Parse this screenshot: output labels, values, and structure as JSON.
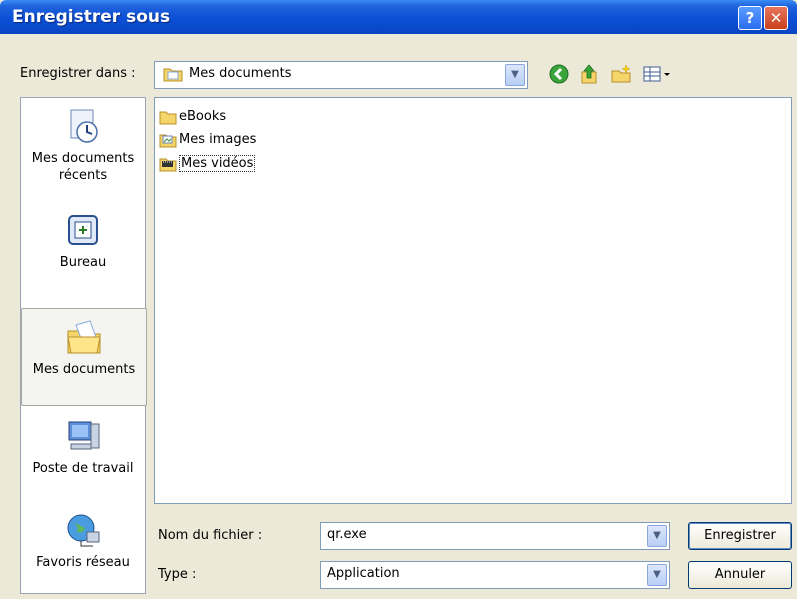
{
  "window": {
    "title": "Enregistrer sous",
    "help_label": "?",
    "close_label": "✕"
  },
  "toolbar": {
    "save_in_label": "Enregistrer dans :",
    "save_in_value": "Mes documents",
    "icons": [
      "back-icon",
      "up-folder-icon",
      "new-folder-icon",
      "view-menu-icon"
    ]
  },
  "places": [
    {
      "label_line1": "Mes documents",
      "label_line2": "récents",
      "icon": "recent-documents-icon",
      "selected": false
    },
    {
      "label_line1": "Bureau",
      "label_line2": "",
      "icon": "desktop-icon",
      "selected": false
    },
    {
      "label_line1": "Mes documents",
      "label_line2": "",
      "icon": "my-documents-icon",
      "selected": true
    },
    {
      "label_line1": "Poste de travail",
      "label_line2": "",
      "icon": "my-computer-icon",
      "selected": false
    },
    {
      "label_line1": "Favoris réseau",
      "label_line2": "",
      "icon": "network-places-icon",
      "selected": false
    }
  ],
  "files": [
    {
      "name": "eBooks",
      "icon": "folder-icon"
    },
    {
      "name": "Mes images",
      "icon": "pictures-folder-icon"
    },
    {
      "name": "Mes vidéos",
      "icon": "videos-folder-icon"
    }
  ],
  "form": {
    "filename_label": "Nom du fichier :",
    "filename_value": "qr.exe",
    "type_label": "Type :",
    "type_value": "Application"
  },
  "buttons": {
    "save": "Enregistrer",
    "cancel": "Annuler"
  },
  "colors": {
    "titlebar": "#0b4fd6",
    "dialog_bg": "#ece9d8",
    "folder": "#f5d56a"
  }
}
